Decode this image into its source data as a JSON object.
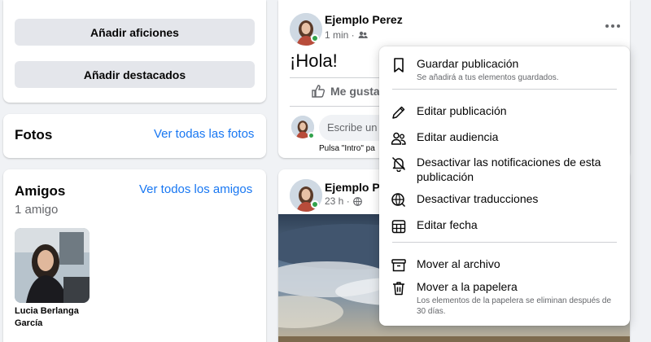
{
  "left_column": {
    "add_hobbies_label": "Añadir aficiones",
    "add_featured_label": "Añadir destacados",
    "photos": {
      "title": "Fotos",
      "see_all": "Ver todas las fotos"
    },
    "friends": {
      "title": "Amigos",
      "count": "1 amigo",
      "see_all": "Ver todos los amigos",
      "items": [
        {
          "name": "Lucia Berlanga García"
        }
      ]
    }
  },
  "post1": {
    "author": "Ejemplo Perez",
    "time": "1 min ·",
    "privacy_icon": "friends-icon",
    "text": "¡Hola!",
    "like_label": "Me gusta",
    "comment_placeholder": "Escribe un c",
    "hint": "Pulsa \"Intro\" pa",
    "more_icon": "ellipsis-icon"
  },
  "post2": {
    "author": "Ejemplo Pere",
    "time": "23 h ·",
    "privacy_icon": "globe-icon"
  },
  "menu": {
    "items": [
      {
        "icon": "bookmark-icon",
        "label": "Guardar publicación",
        "sub": "Se añadirá a tus elementos guardados."
      },
      {
        "icon": "pencil-icon",
        "label": "Editar publicación",
        "sub": ""
      },
      {
        "icon": "people-icon",
        "label": "Editar audiencia",
        "sub": ""
      },
      {
        "icon": "bell-off-icon",
        "label": "Desactivar las notificaciones de esta publicación",
        "sub": ""
      },
      {
        "icon": "globe-translate-icon",
        "label": "Desactivar traducciones",
        "sub": ""
      },
      {
        "icon": "calendar-icon",
        "label": "Editar fecha",
        "sub": ""
      },
      {
        "icon": "archive-icon",
        "label": "Mover al archivo",
        "sub": ""
      },
      {
        "icon": "trash-icon",
        "label": "Mover a la papelera",
        "sub": "Los elementos de la papelera se eliminan después de 30 días."
      }
    ]
  },
  "colors": {
    "accent": "#1877f2",
    "online": "#31a24c",
    "page_bg": "#f0f2f5"
  }
}
